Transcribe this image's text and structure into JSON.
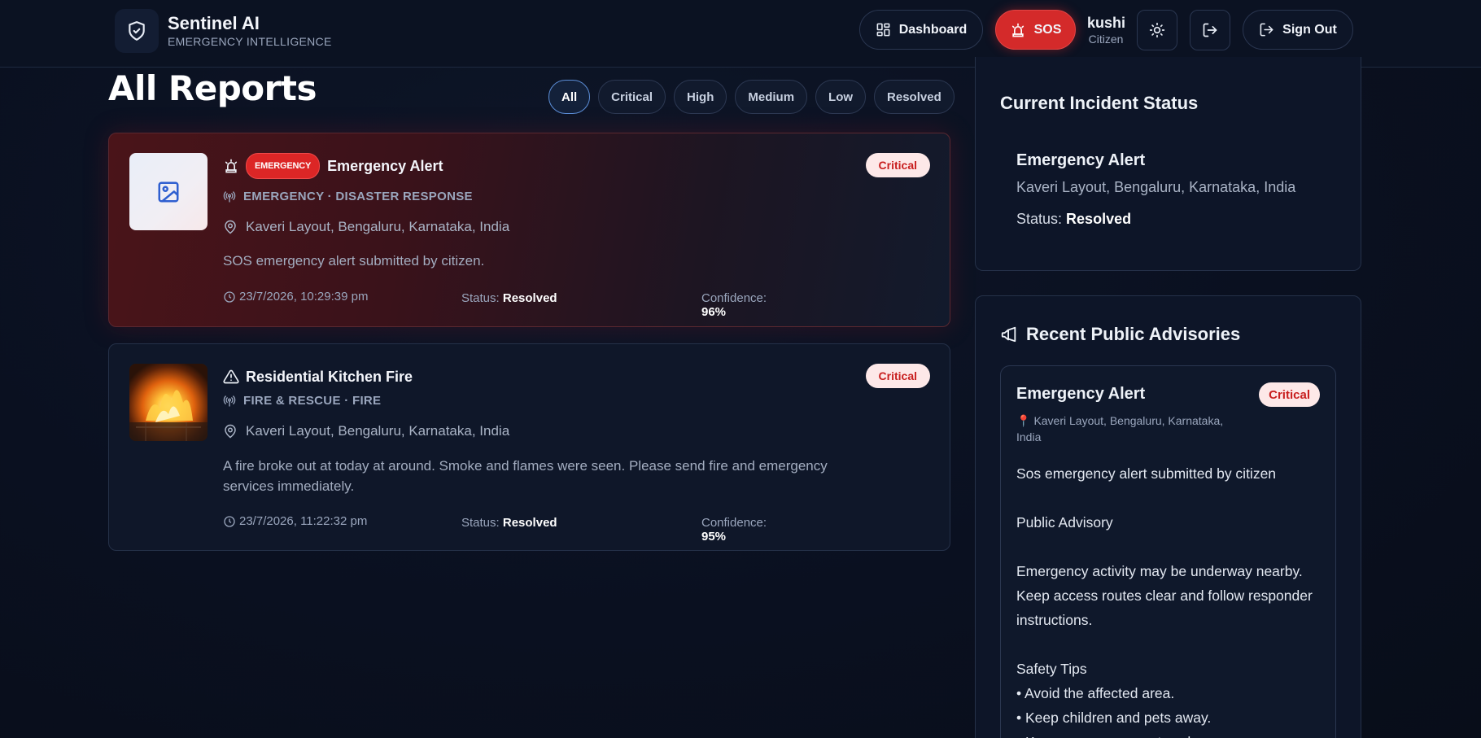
{
  "app": {
    "name": "Sentinel AI",
    "subtitle": "EMERGENCY INTELLIGENCE"
  },
  "header": {
    "dashboard_label": "Dashboard",
    "sos_label": "SOS",
    "user_name": "kushi",
    "user_role": "Citizen",
    "signout_label": "Sign Out"
  },
  "page": {
    "title": "All Reports"
  },
  "filters": [
    "All",
    "Critical",
    "High",
    "Medium",
    "Low",
    "Resolved"
  ],
  "active_filter": "All",
  "reports": [
    {
      "tag": "EMERGENCY",
      "title": "Emergency Alert",
      "severity": "Critical",
      "category": "EMERGENCY · DISASTER RESPONSE",
      "location": "Kaveri Layout, Bengaluru, Karnataka, India",
      "description": "SOS emergency alert submitted by citizen.",
      "timestamp": "23/7/2026, 10:29:39 pm",
      "status_label": "Status:",
      "status": "Resolved",
      "confidence_label": "Confidence:",
      "confidence": "96%",
      "icon": "siren-icon",
      "thumbnail": "image-placeholder-icon"
    },
    {
      "title": "Residential Kitchen Fire",
      "severity": "Critical",
      "category": "FIRE & RESCUE · FIRE",
      "location": "Kaveri Layout, Bengaluru, Karnataka, India",
      "description": "A fire broke out at today at around. Smoke and flames were seen. Please send fire and emergency services immediately.",
      "timestamp": "23/7/2026, 11:22:32 pm",
      "status_label": "Status:",
      "status": "Resolved",
      "confidence_label": "Confidence:",
      "confidence": "95%",
      "icon": "warning-icon",
      "thumbnail": "fire-photo"
    }
  ],
  "incident_status": {
    "heading": "Current Incident Status",
    "title": "Emergency Alert",
    "location": "Kaveri Layout, Bengaluru, Karnataka, India",
    "status_label": "Status:",
    "status": "Resolved"
  },
  "advisories": {
    "heading": "Recent Public Advisories",
    "items": [
      {
        "title": "Emergency Alert",
        "severity": "Critical",
        "location": "Kaveri Layout, Bengaluru, Karnataka, India",
        "line1": "Sos emergency alert submitted by citizen",
        "line2": "Public Advisory",
        "line3": "Emergency activity may be underway nearby. Keep access routes clear and follow responder instructions.",
        "line4": "Safety Tips",
        "tip1": "• Avoid the affected area.",
        "tip2": "• Keep children and pets away.",
        "tip3": "• Keep emergency routes clear."
      }
    ]
  },
  "colors": {
    "background": "#0a1020",
    "accent_red": "#dc2626",
    "critical_badge_bg": "#fde8e8",
    "critical_badge_text": "#c81e1e",
    "active_chip_border": "#5b8dd6"
  }
}
